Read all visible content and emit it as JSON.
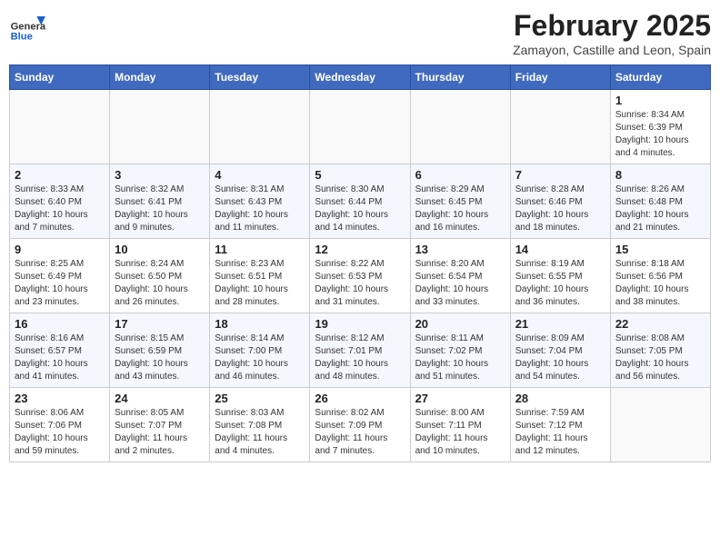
{
  "header": {
    "logo_general": "General",
    "logo_blue": "Blue",
    "month_title": "February 2025",
    "subtitle": "Zamayon, Castille and Leon, Spain"
  },
  "weekdays": [
    "Sunday",
    "Monday",
    "Tuesday",
    "Wednesday",
    "Thursday",
    "Friday",
    "Saturday"
  ],
  "weeks": [
    [
      {
        "day": "",
        "info": ""
      },
      {
        "day": "",
        "info": ""
      },
      {
        "day": "",
        "info": ""
      },
      {
        "day": "",
        "info": ""
      },
      {
        "day": "",
        "info": ""
      },
      {
        "day": "",
        "info": ""
      },
      {
        "day": "1",
        "info": "Sunrise: 8:34 AM\nSunset: 6:39 PM\nDaylight: 10 hours and 4 minutes."
      }
    ],
    [
      {
        "day": "2",
        "info": "Sunrise: 8:33 AM\nSunset: 6:40 PM\nDaylight: 10 hours and 7 minutes."
      },
      {
        "day": "3",
        "info": "Sunrise: 8:32 AM\nSunset: 6:41 PM\nDaylight: 10 hours and 9 minutes."
      },
      {
        "day": "4",
        "info": "Sunrise: 8:31 AM\nSunset: 6:43 PM\nDaylight: 10 hours and 11 minutes."
      },
      {
        "day": "5",
        "info": "Sunrise: 8:30 AM\nSunset: 6:44 PM\nDaylight: 10 hours and 14 minutes."
      },
      {
        "day": "6",
        "info": "Sunrise: 8:29 AM\nSunset: 6:45 PM\nDaylight: 10 hours and 16 minutes."
      },
      {
        "day": "7",
        "info": "Sunrise: 8:28 AM\nSunset: 6:46 PM\nDaylight: 10 hours and 18 minutes."
      },
      {
        "day": "8",
        "info": "Sunrise: 8:26 AM\nSunset: 6:48 PM\nDaylight: 10 hours and 21 minutes."
      }
    ],
    [
      {
        "day": "9",
        "info": "Sunrise: 8:25 AM\nSunset: 6:49 PM\nDaylight: 10 hours and 23 minutes."
      },
      {
        "day": "10",
        "info": "Sunrise: 8:24 AM\nSunset: 6:50 PM\nDaylight: 10 hours and 26 minutes."
      },
      {
        "day": "11",
        "info": "Sunrise: 8:23 AM\nSunset: 6:51 PM\nDaylight: 10 hours and 28 minutes."
      },
      {
        "day": "12",
        "info": "Sunrise: 8:22 AM\nSunset: 6:53 PM\nDaylight: 10 hours and 31 minutes."
      },
      {
        "day": "13",
        "info": "Sunrise: 8:20 AM\nSunset: 6:54 PM\nDaylight: 10 hours and 33 minutes."
      },
      {
        "day": "14",
        "info": "Sunrise: 8:19 AM\nSunset: 6:55 PM\nDaylight: 10 hours and 36 minutes."
      },
      {
        "day": "15",
        "info": "Sunrise: 8:18 AM\nSunset: 6:56 PM\nDaylight: 10 hours and 38 minutes."
      }
    ],
    [
      {
        "day": "16",
        "info": "Sunrise: 8:16 AM\nSunset: 6:57 PM\nDaylight: 10 hours and 41 minutes."
      },
      {
        "day": "17",
        "info": "Sunrise: 8:15 AM\nSunset: 6:59 PM\nDaylight: 10 hours and 43 minutes."
      },
      {
        "day": "18",
        "info": "Sunrise: 8:14 AM\nSunset: 7:00 PM\nDaylight: 10 hours and 46 minutes."
      },
      {
        "day": "19",
        "info": "Sunrise: 8:12 AM\nSunset: 7:01 PM\nDaylight: 10 hours and 48 minutes."
      },
      {
        "day": "20",
        "info": "Sunrise: 8:11 AM\nSunset: 7:02 PM\nDaylight: 10 hours and 51 minutes."
      },
      {
        "day": "21",
        "info": "Sunrise: 8:09 AM\nSunset: 7:04 PM\nDaylight: 10 hours and 54 minutes."
      },
      {
        "day": "22",
        "info": "Sunrise: 8:08 AM\nSunset: 7:05 PM\nDaylight: 10 hours and 56 minutes."
      }
    ],
    [
      {
        "day": "23",
        "info": "Sunrise: 8:06 AM\nSunset: 7:06 PM\nDaylight: 10 hours and 59 minutes."
      },
      {
        "day": "24",
        "info": "Sunrise: 8:05 AM\nSunset: 7:07 PM\nDaylight: 11 hours and 2 minutes."
      },
      {
        "day": "25",
        "info": "Sunrise: 8:03 AM\nSunset: 7:08 PM\nDaylight: 11 hours and 4 minutes."
      },
      {
        "day": "26",
        "info": "Sunrise: 8:02 AM\nSunset: 7:09 PM\nDaylight: 11 hours and 7 minutes."
      },
      {
        "day": "27",
        "info": "Sunrise: 8:00 AM\nSunset: 7:11 PM\nDaylight: 11 hours and 10 minutes."
      },
      {
        "day": "28",
        "info": "Sunrise: 7:59 AM\nSunset: 7:12 PM\nDaylight: 11 hours and 12 minutes."
      },
      {
        "day": "",
        "info": ""
      }
    ]
  ]
}
